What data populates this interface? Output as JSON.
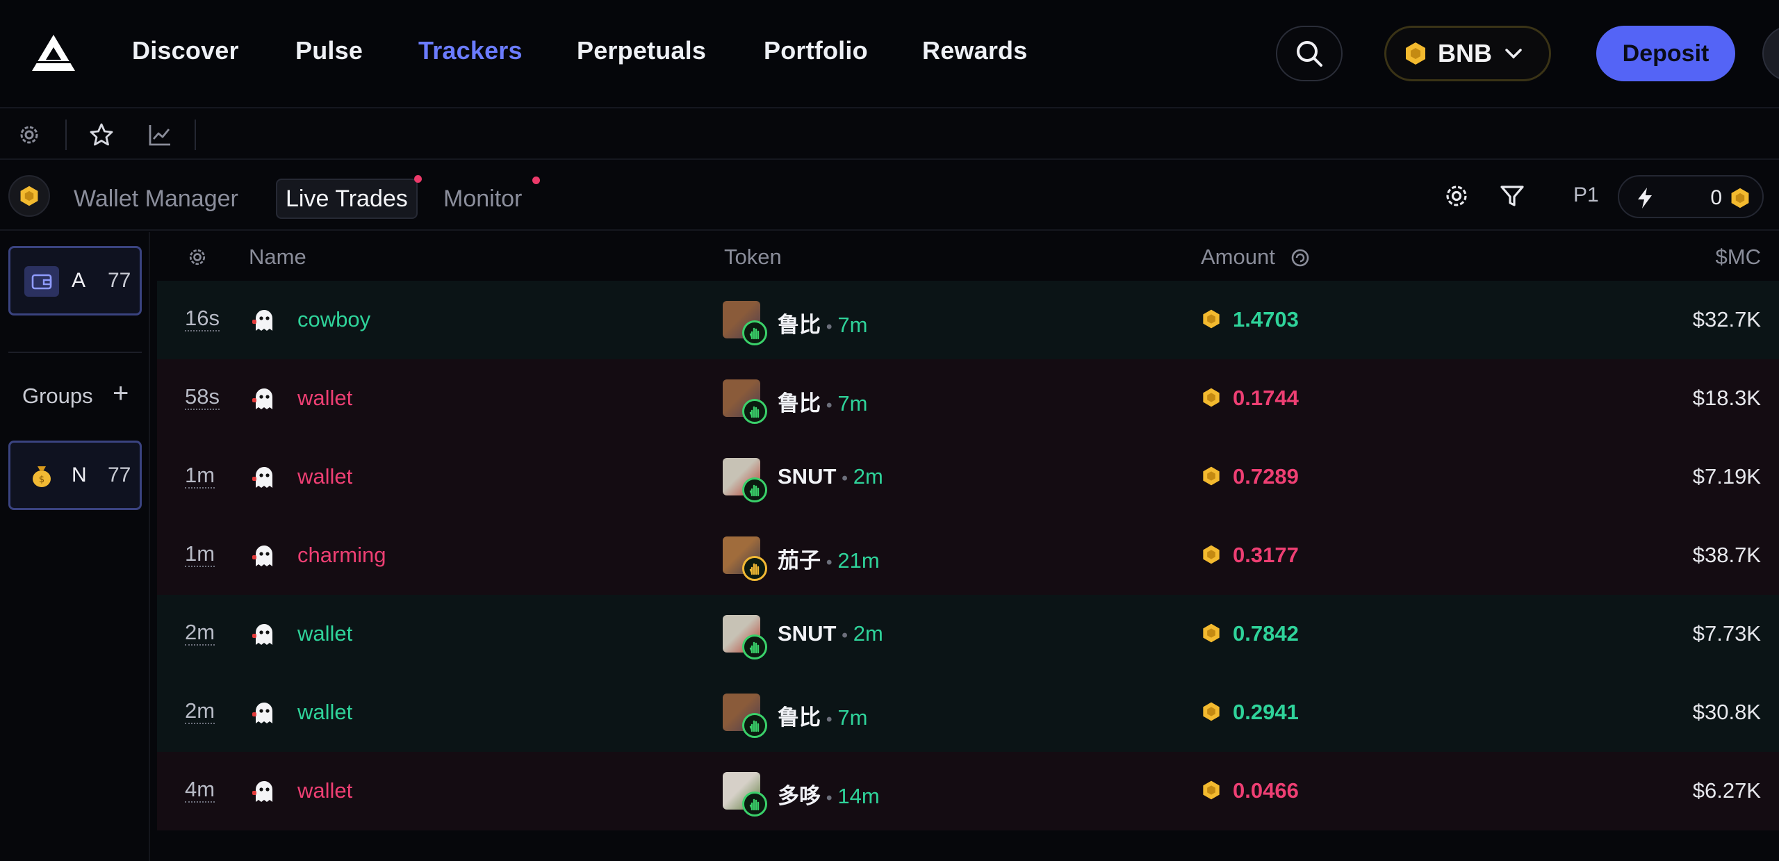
{
  "nav": {
    "items": [
      "Discover",
      "Pulse",
      "Trackers",
      "Perpetuals",
      "Portfolio",
      "Rewards"
    ],
    "active": "Trackers",
    "chain_label": "BNB",
    "deposit_label": "Deposit"
  },
  "tabs": {
    "items": [
      "Wallet Manager",
      "Live Trades",
      "Monitor"
    ],
    "active": "Live Trades",
    "preset": "P1",
    "quick_buy_amount": "0"
  },
  "sidebar": {
    "wallets": [
      {
        "initial": "A",
        "count": "77"
      },
      {
        "initial": "N",
        "count": "77"
      }
    ],
    "groups_label": "Groups"
  },
  "table": {
    "columns": {
      "name": "Name",
      "token": "Token",
      "amount": "Amount",
      "mc": "$MC"
    },
    "rows": [
      {
        "age": "16s",
        "name": "cowboy",
        "side": "buy",
        "token": "鲁比",
        "token_age": "7m",
        "amount": "1.4703",
        "mc": "$32.7K",
        "badge": "green"
      },
      {
        "age": "58s",
        "name": "wallet",
        "side": "sell",
        "token": "鲁比",
        "token_age": "7m",
        "amount": "0.1744",
        "mc": "$18.3K",
        "badge": "green"
      },
      {
        "age": "1m",
        "name": "wallet",
        "side": "sell",
        "token": "SNUT",
        "token_age": "2m",
        "amount": "0.7289",
        "mc": "$7.19K",
        "badge": "green"
      },
      {
        "age": "1m",
        "name": "charming",
        "side": "sell",
        "token": "茄子",
        "token_age": "21m",
        "amount": "0.3177",
        "mc": "$38.7K",
        "badge": "yellow"
      },
      {
        "age": "2m",
        "name": "wallet",
        "side": "buy",
        "token": "SNUT",
        "token_age": "2m",
        "amount": "0.7842",
        "mc": "$7.73K",
        "badge": "green"
      },
      {
        "age": "2m",
        "name": "wallet",
        "side": "buy",
        "token": "鲁比",
        "token_age": "7m",
        "amount": "0.2941",
        "mc": "$30.8K",
        "badge": "green"
      },
      {
        "age": "4m",
        "name": "wallet",
        "side": "sell",
        "token": "多哆",
        "token_age": "14m",
        "amount": "0.0466",
        "mc": "$6.27K",
        "badge": "green"
      }
    ]
  },
  "colors": {
    "accent": "#6b7cff",
    "deposit": "#5464f6",
    "buy": "#2fd39a",
    "sell": "#ee3f73",
    "bnb": "#f3ba2f"
  },
  "icons": [
    "logo-icon",
    "search-icon",
    "bnb-icon",
    "chevron-down-icon",
    "gear-icon",
    "star-icon",
    "chart-icon",
    "filter-icon",
    "lightning-icon",
    "wallet-icon",
    "money-bag-icon",
    "plus-icon",
    "refresh-icon",
    "ghost-avatar-icon"
  ]
}
